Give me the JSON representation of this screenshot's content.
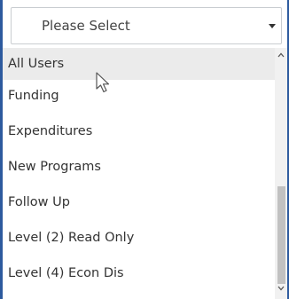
{
  "select": {
    "placeholder_label": "Please Select"
  },
  "options": [
    {
      "label": "All Users",
      "hovered": true
    },
    {
      "label": "Funding",
      "hovered": false
    },
    {
      "label": "Expenditures",
      "hovered": false
    },
    {
      "label": "New Programs",
      "hovered": false
    },
    {
      "label": "Follow Up",
      "hovered": false
    },
    {
      "label": "Level (2) Read Only",
      "hovered": false
    },
    {
      "label": "Level (4) Econ Dis",
      "hovered": false
    }
  ],
  "icons": {
    "caret": "chevron-down-icon",
    "scroll_up": "chevron-up-icon",
    "scroll_down": "chevron-down-icon",
    "cursor": "mouse-pointer-icon"
  },
  "colors": {
    "accent_border": "#2d5a9e",
    "hover_background": "#ebebeb",
    "text": "#333333"
  }
}
